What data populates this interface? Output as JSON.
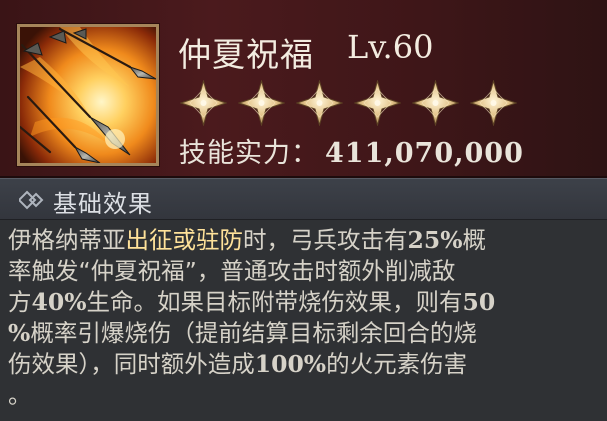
{
  "skill": {
    "name": "仲夏祝福",
    "level": "Lv.60",
    "icon": "spear-fire-icon",
    "stars_filled": 6,
    "stars_total": 6,
    "power_label": "技能实力：",
    "power_value": "411,070,000"
  },
  "section": {
    "icon": "double-diamond-icon",
    "title": "基础效果"
  },
  "description": {
    "lines": [
      [
        {
          "text": "伊格纳蒂亚",
          "style": "plain"
        },
        {
          "text": "出征或驻防",
          "style": "highlight"
        },
        {
          "text": "时，弓兵攻击有",
          "style": "plain"
        },
        {
          "text": "25%",
          "style": "number"
        },
        {
          "text": "概",
          "style": "plain"
        }
      ],
      [
        {
          "text": "率触发“仲夏祝福”，普通攻击时额外削减敌",
          "style": "plain"
        }
      ],
      [
        {
          "text": "方",
          "style": "plain"
        },
        {
          "text": "40%",
          "style": "number"
        },
        {
          "text": "生命。如果目标附带烧伤效果，则有",
          "style": "plain"
        },
        {
          "text": "50",
          "style": "number"
        }
      ],
      [
        {
          "text": "%",
          "style": "number"
        },
        {
          "text": "概率引爆烧伤（提前结算目标剩余回合的烧",
          "style": "plain"
        }
      ],
      [
        {
          "text": "伤效果），同时额外造成",
          "style": "plain"
        },
        {
          "text": "100%",
          "style": "number"
        },
        {
          "text": "的火元素伤害",
          "style": "plain"
        }
      ],
      [
        {
          "text": "。",
          "style": "plain"
        }
      ]
    ]
  },
  "colors": {
    "header_bg": "#4b1a1d",
    "frame_gold": "#a6855a",
    "star_gold": "#e2c38a",
    "highlight": "#ffe29a",
    "body_text": "#d6d2c8",
    "section_bg": "#3d4149"
  }
}
